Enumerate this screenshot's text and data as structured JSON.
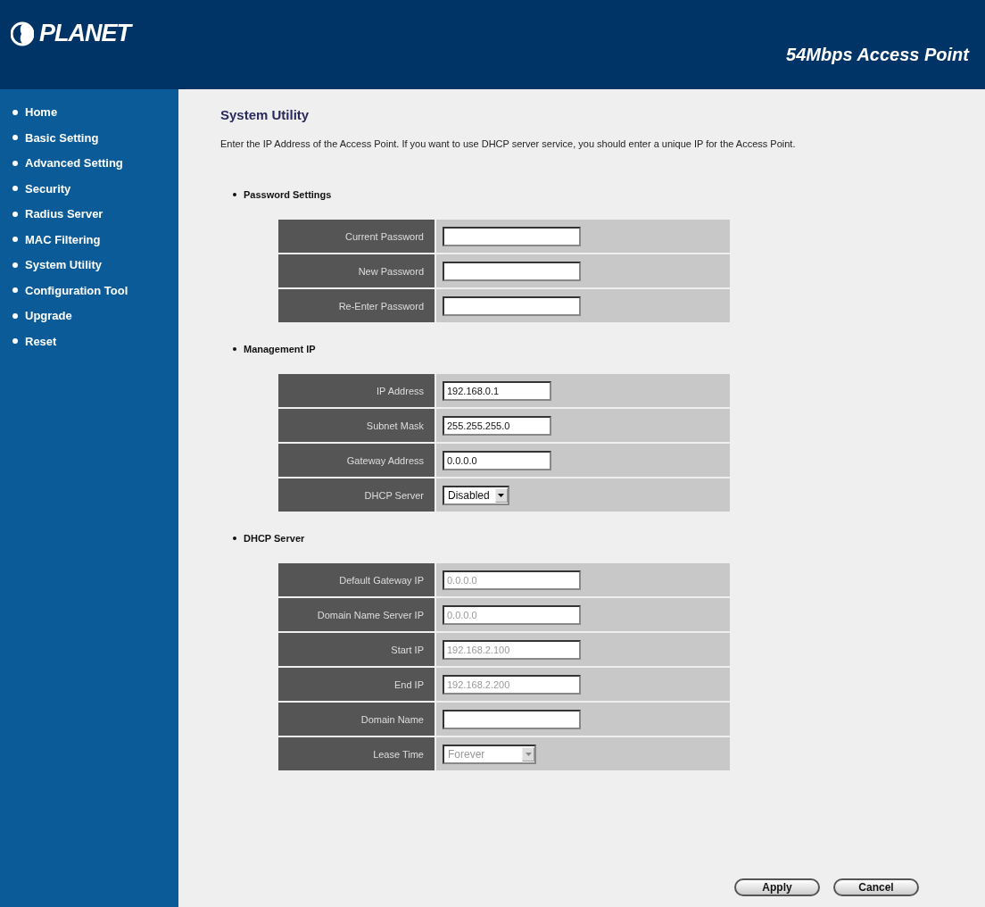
{
  "header": {
    "logo_text": "PLANET",
    "product": "54Mbps Access Point"
  },
  "sidebar": {
    "items": [
      {
        "label": "Home"
      },
      {
        "label": "Basic Setting"
      },
      {
        "label": "Advanced Setting"
      },
      {
        "label": "Security"
      },
      {
        "label": "Radius Server"
      },
      {
        "label": "MAC Filtering"
      },
      {
        "label": "System Utility"
      },
      {
        "label": "Configuration Tool"
      },
      {
        "label": "Upgrade"
      },
      {
        "label": "Reset"
      }
    ]
  },
  "page": {
    "title": "System Utility",
    "description": "Enter the IP Address of the Access Point. If you want to use DHCP server service, you should enter a unique IP for the Access Point.",
    "sections": [
      {
        "heading": "Password Settings",
        "fields": [
          {
            "label": "Current Password",
            "kind": "password"
          },
          {
            "label": "New Password",
            "kind": "password"
          },
          {
            "label": "Re-Enter Password",
            "kind": "password"
          }
        ]
      },
      {
        "heading": "Management IP",
        "fields": [
          {
            "label": "IP Address",
            "kind": "text",
            "value": "192.168.0.1",
            "disabled": false
          },
          {
            "label": "Subnet Mask",
            "kind": "text",
            "value": "255.255.255.0",
            "disabled": false
          },
          {
            "label": "Gateway Address",
            "kind": "text",
            "value": "0.0.0.0",
            "disabled": false
          },
          {
            "label": "DHCP Server",
            "kind": "select",
            "value": "Disabled",
            "disabled": false
          }
        ]
      },
      {
        "heading": "DHCP Server",
        "fields": [
          {
            "label": "Default Gateway IP",
            "kind": "text",
            "value": "0.0.0.0",
            "disabled": true
          },
          {
            "label": "Domain Name Server IP",
            "kind": "text",
            "value": "0.0.0.0",
            "disabled": true
          },
          {
            "label": "Start IP",
            "kind": "text",
            "value": "192.168.2.100",
            "disabled": true
          },
          {
            "label": "End IP",
            "kind": "text",
            "value": "192.168.2.200",
            "disabled": true
          },
          {
            "label": "Domain Name",
            "kind": "text"
          },
          {
            "label": "Lease Time",
            "kind": "select",
            "value": "Forever",
            "disabled": true
          }
        ]
      }
    ],
    "buttons": [
      "Apply",
      "Cancel"
    ]
  }
}
